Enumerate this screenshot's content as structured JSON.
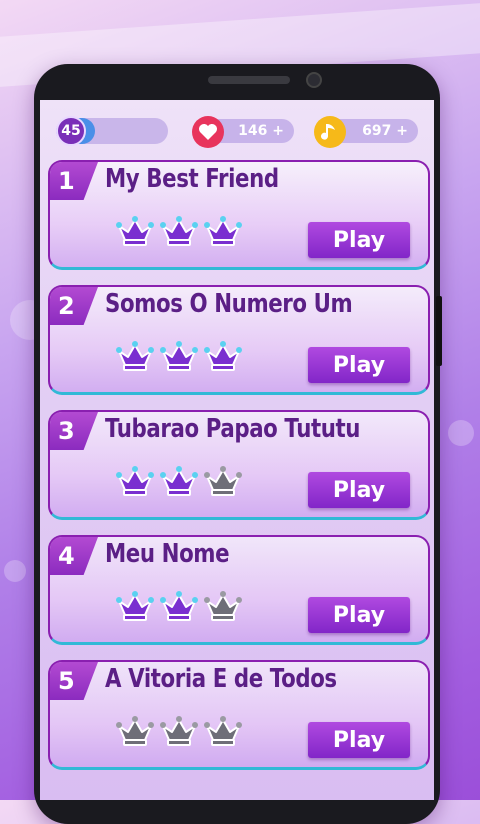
{
  "hud": {
    "level": "45",
    "level_progress": 0.35,
    "lives": "146 +",
    "notes": "697 +"
  },
  "icons": {
    "lives": "heart-icon",
    "notes": "music-note-icon",
    "rating": "crown-icon"
  },
  "colors": {
    "crown_earned": "#7a2fd0",
    "crown_empty": "#6e6e78",
    "play_button": "#8f30d0",
    "heart": "#e8345c",
    "note": "#f6b919"
  },
  "songs": [
    {
      "number": "1",
      "title": "My Best Friend",
      "crowns": 3,
      "play_label": "Play"
    },
    {
      "number": "2",
      "title": "Somos O Numero Um",
      "crowns": 3,
      "play_label": "Play"
    },
    {
      "number": "3",
      "title": "Tubarao Papao Tututu",
      "crowns": 2,
      "play_label": "Play"
    },
    {
      "number": "4",
      "title": "Meu Nome",
      "crowns": 2,
      "play_label": "Play"
    },
    {
      "number": "5",
      "title": "A Vitoria E de Todos",
      "crowns": 0,
      "play_label": "Play"
    }
  ]
}
